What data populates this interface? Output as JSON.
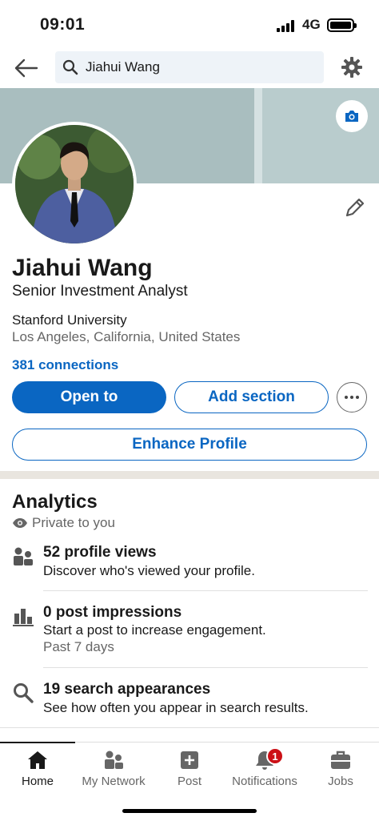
{
  "status": {
    "time": "09:01",
    "network": "4G"
  },
  "search": {
    "query": "Jiahui Wang"
  },
  "profile": {
    "name": "Jiahui Wang",
    "headline": "Senior Investment Analyst",
    "school": "Stanford University",
    "location": "Los Angeles, California, United States",
    "connections": "381 connections"
  },
  "actions": {
    "open_to": "Open to",
    "add_section": "Add section",
    "enhance": "Enhance Profile"
  },
  "analytics": {
    "title": "Analytics",
    "privacy": "Private to you",
    "items": [
      {
        "title": "52 profile views",
        "subtitle": "Discover who's viewed your profile.",
        "meta": "",
        "icon": "people-icon"
      },
      {
        "title": "0 post impressions",
        "subtitle": "Start a post to increase engagement.",
        "meta": "Past 7 days",
        "icon": "bar-chart-icon"
      },
      {
        "title": "19 search appearances",
        "subtitle": "See how often you appear in search results.",
        "meta": "",
        "icon": "search-icon"
      }
    ]
  },
  "tabs": [
    {
      "label": "Home",
      "icon": "home-icon",
      "active": true
    },
    {
      "label": "My Network",
      "icon": "network-icon"
    },
    {
      "label": "Post",
      "icon": "post-icon"
    },
    {
      "label": "Notifications",
      "icon": "bell-icon",
      "badge": "1"
    },
    {
      "label": "Jobs",
      "icon": "briefcase-icon"
    }
  ],
  "colors": {
    "accent": "#0a66c2",
    "badge": "#cc1016",
    "banner": "#a9bebf"
  }
}
